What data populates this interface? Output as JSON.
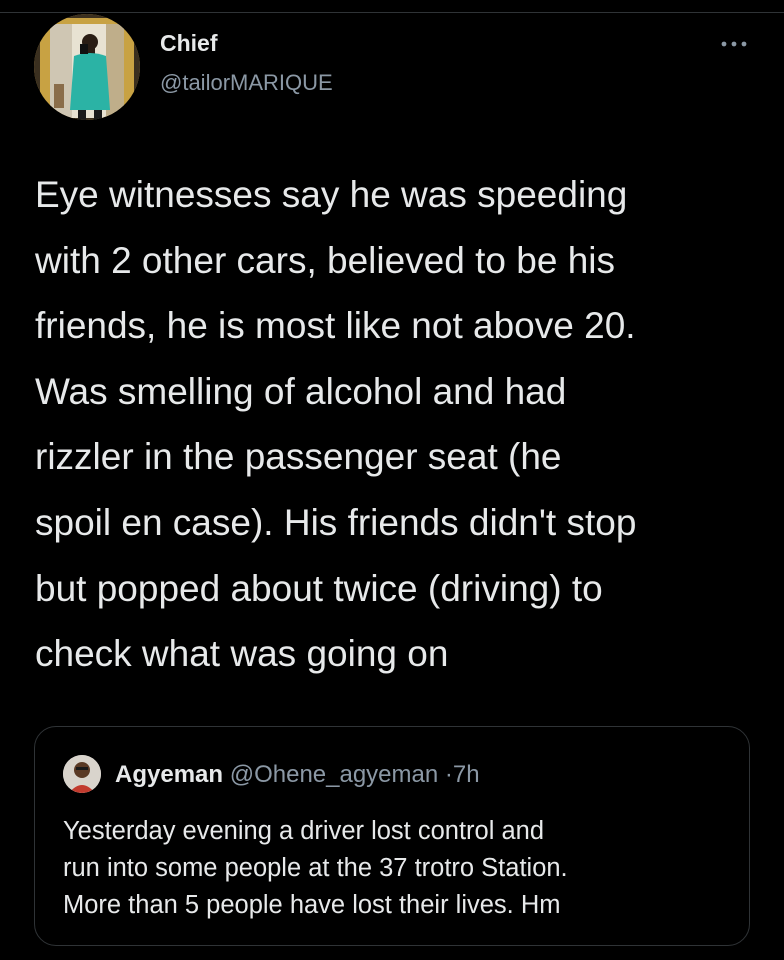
{
  "tweet": {
    "author": {
      "display_name": "Chief",
      "handle": "@tailorMARIQUE"
    },
    "more_icon": "more-horizontal-icon",
    "text_lines": [
      "Eye witnesses say he was speeding",
      "with 2 other cars, believed to be his",
      "friends, he is most like not above 20.",
      "Was smelling of alcohol and had",
      "rizzler in the passenger seat (he",
      "spoil en case). His friends didn't stop",
      "but popped about twice (driving) to",
      "check what was going on"
    ]
  },
  "quoted_tweet": {
    "display_name": "Agyeman",
    "handle": "@Ohene_agyeman",
    "separator": "·",
    "time": "7h",
    "text_lines": [
      "Yesterday evening a driver lost control and",
      "run into some people at the 37 trotro Station.",
      "More than 5 people have lost their lives. Hm"
    ]
  },
  "colors": {
    "background": "#000000",
    "text_primary": "#e7e9ea",
    "text_secondary": "#8b98a5",
    "border": "#2f3336"
  }
}
